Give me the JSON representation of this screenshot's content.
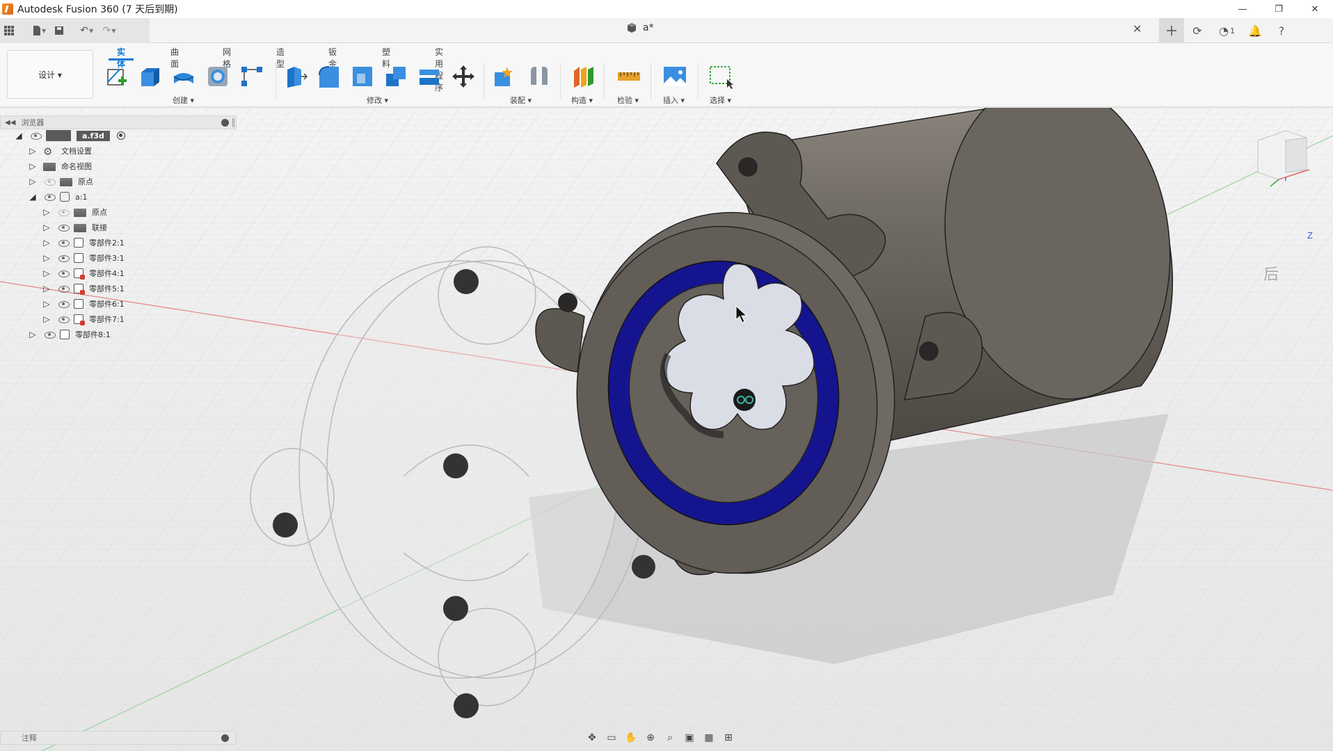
{
  "titlebar": {
    "title": "Autodesk Fusion 360 (7 天后到期)",
    "icons": [
      "fusion-logo-icon",
      "minimize-icon",
      "restore-icon",
      "close-icon"
    ]
  },
  "quick_access": {
    "icons": [
      "app-grid-icon",
      "file-icon",
      "save-icon",
      "undo-icon",
      "redo-icon"
    ],
    "document_tab": "a*",
    "right_icons": [
      "new-tab-icon",
      "extensions-icon",
      "job-status-icon",
      "notifications-icon",
      "help-icon"
    ],
    "job_count": "1"
  },
  "toolbar": {
    "workspace": "设计 ▾",
    "tabs": [
      "实体",
      "曲面",
      "网格",
      "造型",
      "钣金",
      "塑料",
      "实用程序"
    ],
    "active_tab": "实体",
    "groups": {
      "create": "创建 ▾",
      "modify": "修改 ▾",
      "assemble": "装配 ▾",
      "construct": "构造 ▾",
      "inspect": "检验 ▾",
      "insert": "插入 ▾",
      "select": "选择 ▾"
    }
  },
  "browser": {
    "title": "浏览器",
    "items": [
      {
        "label": "a.f3d",
        "level": 0,
        "expanded": true,
        "type": "root"
      },
      {
        "label": "文档设置",
        "level": 1,
        "expanded": false,
        "type": "settings"
      },
      {
        "label": "命名视图",
        "level": 1,
        "expanded": false,
        "type": "folder"
      },
      {
        "label": "原点",
        "level": 1,
        "expanded": false,
        "type": "folder",
        "hidden": true
      },
      {
        "label": "a:1",
        "level": 1,
        "expanded": true,
        "type": "component"
      },
      {
        "label": "原点",
        "level": 2,
        "expanded": false,
        "type": "folder",
        "hidden": true
      },
      {
        "label": "联接",
        "level": 2,
        "expanded": false,
        "type": "folder"
      },
      {
        "label": "零部件2:1",
        "level": 2,
        "expanded": false,
        "type": "body"
      },
      {
        "label": "零部件3:1",
        "level": 2,
        "expanded": false,
        "type": "body"
      },
      {
        "label": "零部件4:1",
        "level": 2,
        "expanded": false,
        "type": "body-linked"
      },
      {
        "label": "零部件5:1",
        "level": 2,
        "expanded": false,
        "type": "body-linked"
      },
      {
        "label": "零部件6:1",
        "level": 2,
        "expanded": false,
        "type": "body"
      },
      {
        "label": "零部件7:1",
        "level": 2,
        "expanded": false,
        "type": "body-linked"
      },
      {
        "label": "零部件8:1",
        "level": 1,
        "expanded": false,
        "type": "body"
      }
    ]
  },
  "comments": {
    "title": "注释"
  },
  "viewcube": {
    "face": "后",
    "axis": "Z"
  },
  "navbar": {
    "icons": [
      "orbit-icon",
      "look-at-icon",
      "pan-icon",
      "zoom-icon",
      "fit-icon",
      "display-settings-icon",
      "grid-icon",
      "viewports-icon"
    ]
  },
  "colors": {
    "accent": "#0a78d4",
    "ring": "#15148f",
    "part": "#6f6a63",
    "shaft": "#dadde6"
  }
}
